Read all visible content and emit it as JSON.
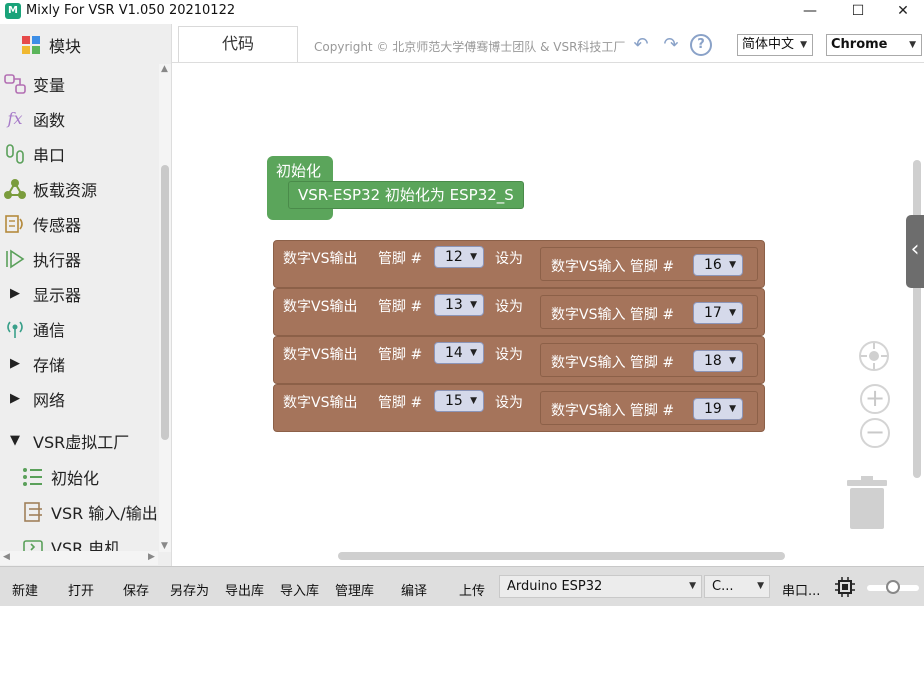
{
  "window": {
    "title": "Mixly For VSR V1.050 20210122",
    "icon_text": "M",
    "minimize": "—",
    "maximize": "☐",
    "close": "✕"
  },
  "sidebar": {
    "items": [
      {
        "label": "模块",
        "icon": "puzzle-icon"
      },
      {
        "label": "变量",
        "icon": "variable-icon"
      },
      {
        "label": "函数",
        "icon": "function-icon"
      },
      {
        "label": "串口",
        "icon": "serial-icon"
      },
      {
        "label": "板载资源",
        "icon": "board-icon"
      },
      {
        "label": "传感器",
        "icon": "sensor-icon"
      },
      {
        "label": "执行器",
        "icon": "actuator-icon"
      },
      {
        "label": "显示器",
        "icon": "triangle-right-icon"
      },
      {
        "label": "通信",
        "icon": "signal-icon"
      },
      {
        "label": "存储",
        "icon": "triangle-right-icon"
      },
      {
        "label": "网络",
        "icon": "triangle-right-icon"
      },
      {
        "label": "VSR虚拟工厂",
        "icon": "triangle-down-icon"
      },
      {
        "label": "初始化",
        "icon": "list-icon"
      },
      {
        "label": "VSR 输入/输出",
        "icon": "io-icon"
      },
      {
        "label": "VSR 电机",
        "icon": "motor-icon"
      }
    ]
  },
  "header": {
    "tab_code": "代码",
    "copyright": "Copyright © 北京师范大学傅骞博士团队 & VSR科技工厂",
    "language": "简体中文",
    "browser": "Chrome"
  },
  "workspace": {
    "init_block": {
      "label": "初始化",
      "inner": "VSR-ESP32  初始化为 ESP32_S"
    },
    "rows": [
      {
        "out_label": "数字VS输出",
        "pin_label": "管脚 #",
        "out_pin": "12",
        "set_label": "设为",
        "in_label": "数字VS输入 管脚  #",
        "in_pin": "16"
      },
      {
        "out_label": "数字VS输出",
        "pin_label": "管脚 #",
        "out_pin": "13",
        "set_label": "设为",
        "in_label": "数字VS输入 管脚  #",
        "in_pin": "17"
      },
      {
        "out_label": "数字VS输出",
        "pin_label": "管脚 #",
        "out_pin": "14",
        "set_label": "设为",
        "in_label": "数字VS输入 管脚  #",
        "in_pin": "18"
      },
      {
        "out_label": "数字VS输出",
        "pin_label": "管脚 #",
        "out_pin": "15",
        "set_label": "设为",
        "in_label": "数字VS输入 管脚  #",
        "in_pin": "19"
      }
    ]
  },
  "bottombar": {
    "new": "新建",
    "open": "打开",
    "save": "保存",
    "save_as": "另存为",
    "export_lib": "导出库",
    "import_lib": "导入库",
    "manage_lib": "管理库",
    "compile": "编译",
    "upload": "上传",
    "board": "Arduino ESP32",
    "port": "C...",
    "serial": "串口..."
  },
  "colors": {
    "accent_green": "#5ba55b",
    "block_brown": "#a5745b",
    "pill_blue": "#d5d9ea"
  }
}
